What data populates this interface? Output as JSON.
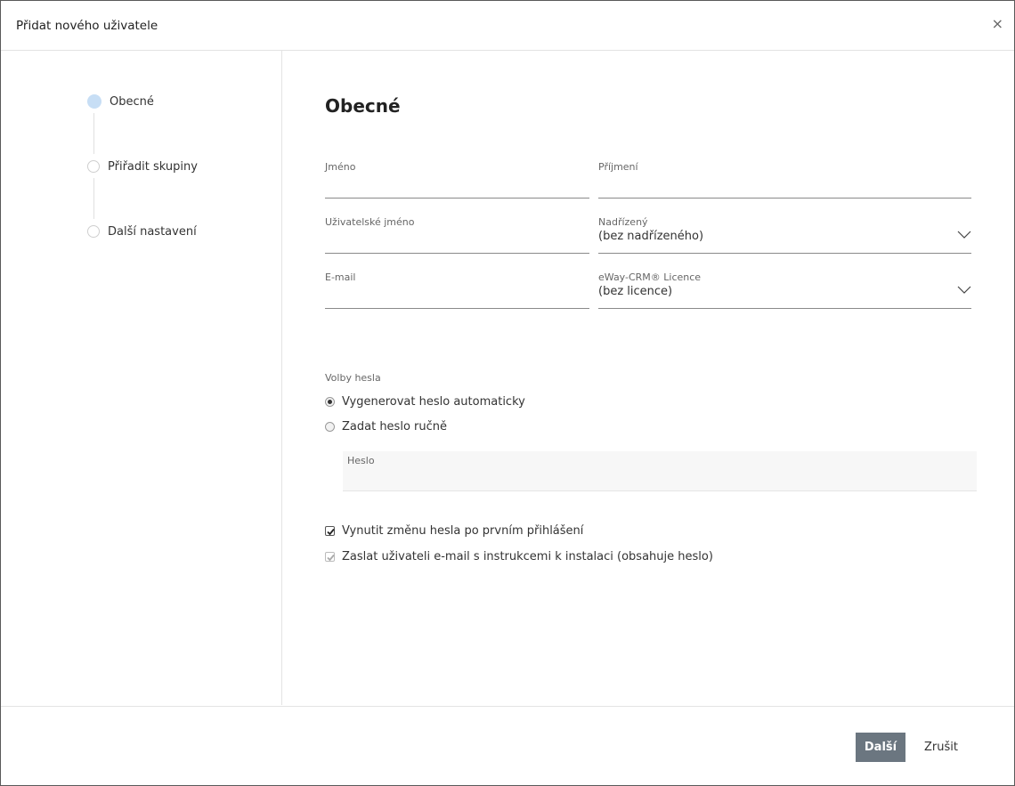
{
  "dialog": {
    "title": "Přidat nového uživatele",
    "close_symbol": "×"
  },
  "steps": [
    {
      "label": "Obecné",
      "active": true
    },
    {
      "label": "Přiřadit skupiny",
      "active": false
    },
    {
      "label": "Další nastavení",
      "active": false
    }
  ],
  "section": {
    "title": "Obecné"
  },
  "fields": {
    "first_name": {
      "label": "Jméno",
      "value": ""
    },
    "last_name": {
      "label": "Příjmení",
      "value": ""
    },
    "username": {
      "label": "Uživatelské jméno",
      "value": ""
    },
    "supervisor": {
      "label": "Nadřízený",
      "value": "(bez nadřízeného)"
    },
    "email": {
      "label": "E-mail",
      "value": ""
    },
    "license": {
      "label": "eWay-CRM® Licence",
      "value": "(bez licence)"
    }
  },
  "password": {
    "label": "Volby hesla",
    "option_auto": "Vygenerovat heslo automaticky",
    "option_manual": "Zadat heslo ručně",
    "selected": "auto",
    "field_label": "Heslo"
  },
  "checkboxes": {
    "force_change": {
      "label": "Vynutit změnu hesla po prvním přihlášení",
      "checked": true
    },
    "send_email": {
      "label": "Zaslat uživateli e-mail s instrukcemi k instalaci (obsahuje heslo)",
      "checked": true,
      "disabled": true
    }
  },
  "footer": {
    "next_label": "Další",
    "cancel_label": "Zrušit"
  },
  "colors": {
    "active_step": "#c7def5",
    "primary_button": "#6b7680"
  }
}
